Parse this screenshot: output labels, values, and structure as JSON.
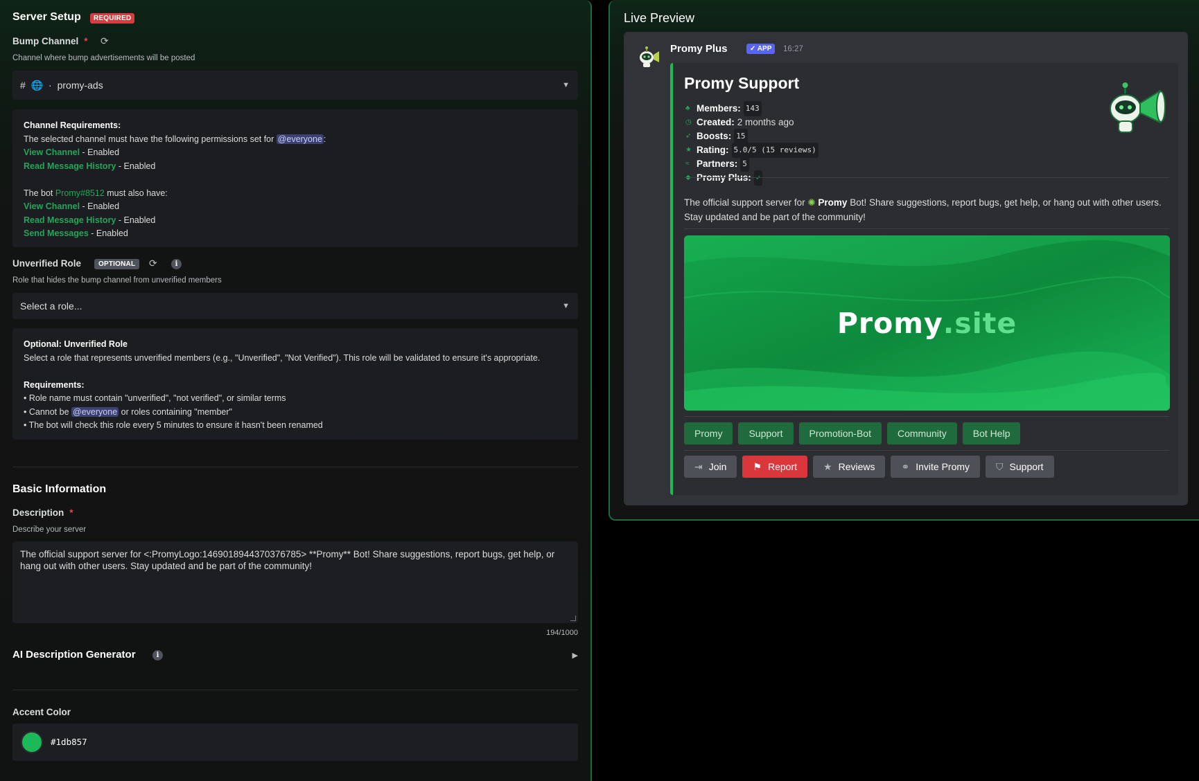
{
  "server_setup": {
    "title": "Server Setup",
    "required_badge": "REQUIRED",
    "bump_channel": {
      "label": "Bump Channel",
      "required_mark": "*",
      "hint": "Channel where bump advertisements will be posted",
      "selected_prefix": "#",
      "selected": "promy-ads"
    },
    "channel_requirements": {
      "title": "Channel Requirements:",
      "intro_pre": "The selected channel must have the following permissions set for",
      "intro_mention": "@everyone",
      "intro_post": ":",
      "perms": [
        {
          "name": "View Channel",
          "state": " - Enabled"
        },
        {
          "name": "Read Message History",
          "state": " - Enabled"
        }
      ],
      "bot_pre": "The bot",
      "bot_name": "Promy#8512",
      "bot_post": "must also have:",
      "bot_perms": [
        {
          "name": "View Channel",
          "state": " - Enabled"
        },
        {
          "name": "Read Message History",
          "state": " - Enabled"
        },
        {
          "name": "Send Messages",
          "state": " - Enabled"
        }
      ]
    },
    "unverified_role": {
      "label": "Unverified Role",
      "optional_badge": "OPTIONAL",
      "hint": "Role that hides the bump channel from unverified members",
      "placeholder": "Select a role..."
    },
    "unverified_info": {
      "title": "Optional: Unverified Role",
      "text": "Select a role that represents unverified members (e.g., \"Unverified\", \"Not Verified\"). This role will be validated to ensure it's appropriate.",
      "req_title": "Requirements:",
      "req1": "• Role name must contain \"unverified\", \"not verified\", or similar terms",
      "req2_pre": "• Cannot be",
      "req2_mention": "@everyone",
      "req2_post": "or roles containing \"member\"",
      "req3": "• The bot will check this role every 5 minutes to ensure it hasn't been renamed"
    }
  },
  "basic_info": {
    "title": "Basic Information",
    "description": {
      "label": "Description",
      "required_mark": "*",
      "hint": "Describe your server",
      "value": "The official support server for <:PromyLogo:1469018944370376785> **Promy** Bot! Share suggestions, report bugs, get help, or hang out with other users. Stay updated and be part of the community!",
      "counter": "194/1000"
    },
    "ai_generator": {
      "label": "AI Description Generator"
    },
    "accent_color": {
      "label": "Accent Color",
      "value": "#1db857"
    }
  },
  "live_preview": {
    "title": "Live Preview",
    "author": "Promy Plus",
    "app_badge": "APP",
    "time": "16:27",
    "embed": {
      "title": "Promy Support",
      "accent": "#1db857",
      "stats": [
        {
          "icon": "members-icon",
          "label": "Members:",
          "value": "143",
          "code": true
        },
        {
          "icon": "clock-icon",
          "label": "Created:",
          "value": "2 months ago",
          "code": false
        },
        {
          "icon": "rocket-icon",
          "label": "Boosts:",
          "value": "15",
          "code": true
        },
        {
          "icon": "star-icon",
          "label": "Rating:",
          "value": "5.0/5 (15 reviews)",
          "code": true
        },
        {
          "icon": "handshake-icon",
          "label": "Partners:",
          "value": "5",
          "code": true
        },
        {
          "icon": "gem-icon",
          "label": "Promy Plus:",
          "value": "✓",
          "code": false
        }
      ],
      "desc_pre": "The official support server for",
      "desc_bold": "Promy",
      "desc_post": "Bot! Share suggestions, report bugs, get help, or hang out with other users. Stay updated and be part of the community!",
      "banner_text_main": "Promy",
      "banner_text_accent": ".site",
      "tags": [
        "Promy",
        "Support",
        "Promotion-Bot",
        "Community",
        "Bot Help"
      ],
      "buttons": [
        {
          "label": "Join",
          "icon": "door-icon",
          "style": "grey"
        },
        {
          "label": "Report",
          "icon": "flag-icon",
          "style": "red"
        },
        {
          "label": "Reviews",
          "icon": "star-icon",
          "style": "grey"
        },
        {
          "label": "Invite Promy",
          "icon": "link-icon",
          "style": "grey"
        },
        {
          "label": "Support",
          "icon": "shield-icon",
          "style": "grey"
        }
      ]
    }
  }
}
